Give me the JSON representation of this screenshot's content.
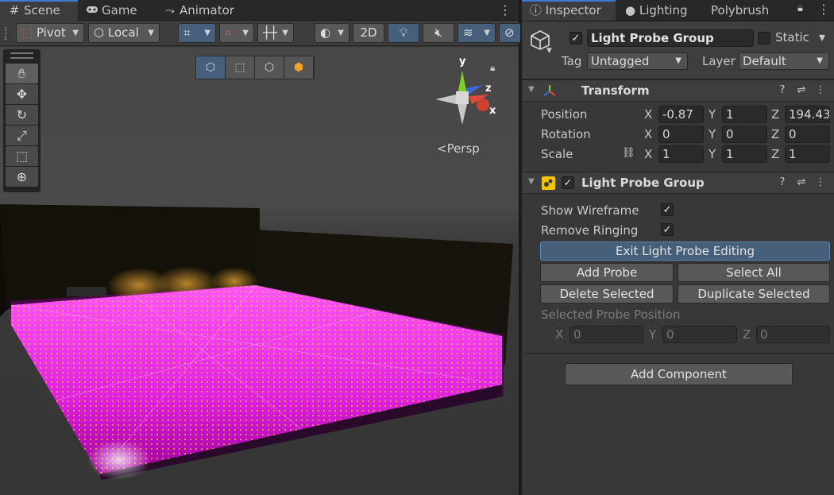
{
  "scene_tabs": [
    {
      "label": "Scene",
      "icon": "grid-icon"
    },
    {
      "label": "Game",
      "icon": "gamepad-icon"
    },
    {
      "label": "Animator",
      "icon": "animator-icon"
    }
  ],
  "toolbar": {
    "pivot_label": "Pivot",
    "space_label": "Local",
    "mode_2d_label": "2D"
  },
  "viewport": {
    "projection_label": "<Persp",
    "axis_y": "y",
    "axis_z": "z",
    "axis_x": "x"
  },
  "inspector_tabs": [
    "Inspector",
    "Lighting",
    "Polybrush"
  ],
  "object": {
    "name": "Light Probe Group",
    "active": true,
    "static_label": "Static",
    "static_checked": false,
    "tag_label": "Tag",
    "tag_value": "Untagged",
    "layer_label": "Layer",
    "layer_value": "Default"
  },
  "transform": {
    "title": "Transform",
    "position_label": "Position",
    "rotation_label": "Rotation",
    "scale_label": "Scale",
    "axes": [
      "X",
      "Y",
      "Z"
    ],
    "position": [
      "-0.87",
      "1",
      "194.43"
    ],
    "rotation": [
      "0",
      "0",
      "0"
    ],
    "scale": [
      "1",
      "1",
      "1"
    ]
  },
  "light_probe_group": {
    "title": "Light Probe Group",
    "enabled": true,
    "show_wireframe_label": "Show Wireframe",
    "show_wireframe": true,
    "remove_ringing_label": "Remove Ringing",
    "remove_ringing": true,
    "exit_editing_label": "Exit Light Probe Editing",
    "add_probe_label": "Add Probe",
    "select_all_label": "Select All",
    "delete_selected_label": "Delete Selected",
    "duplicate_selected_label": "Duplicate Selected",
    "selected_position_label": "Selected Probe Position",
    "selected_position": [
      "0",
      "0",
      "0"
    ]
  },
  "add_component_label": "Add Component",
  "colors": {
    "accent_blue": "#46607c",
    "tab_highlight": "#3a7bd5",
    "probe_magenta": "#ff33ff",
    "probe_yellow": "#f0e000"
  }
}
